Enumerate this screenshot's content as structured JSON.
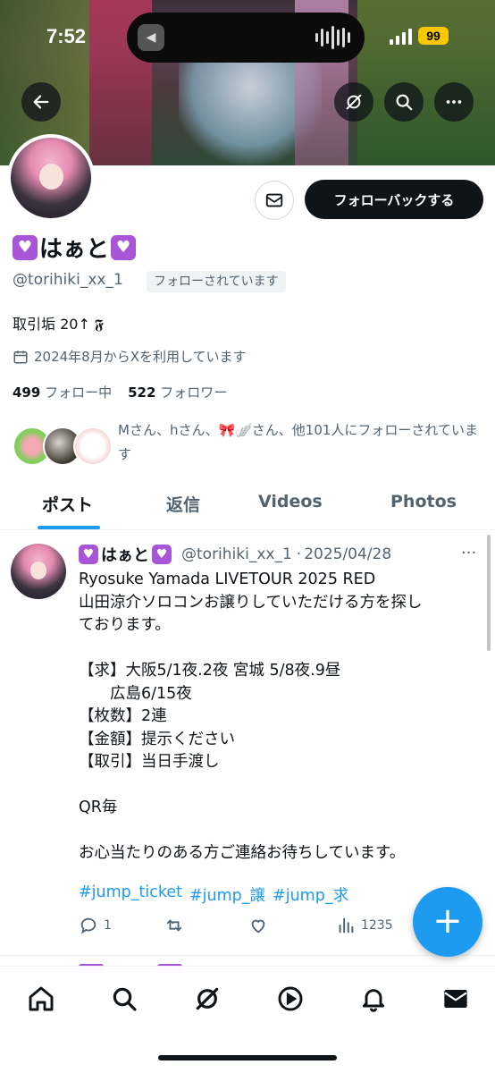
{
  "status_bar": {
    "time": "7:52",
    "battery": "99"
  },
  "profile": {
    "name": "はぁと",
    "handle": "@torihiki_xx_1",
    "follows_you": "フォローされています",
    "follow_back_label": "フォローバックする",
    "bio": "取引垢 20↑ 𝕱",
    "joined": "2024年8月からXを利用しています",
    "following_count": "499",
    "following_label": "フォロー中",
    "followers_count": "522",
    "followers_label": "フォロワー",
    "mutuals_text": "Mさん、hさん、🎀🪽さん、他101人にフォローされています"
  },
  "tabs": [
    "ポスト",
    "返信",
    "Videos",
    "Photos"
  ],
  "tweet": {
    "name": "はぁと",
    "handle": "@torihiki_xx_1",
    "date": "2025/04/28",
    "lines": [
      "Ryosuke Yamada LIVETOUR 2025 RED",
      "山田涼介ソロコンお譲りしていただける方を探し",
      "ております。",
      "",
      "【求】大阪5/1夜.2夜 宮城 5/8夜.9昼",
      "　　広島6/15夜",
      "【枚数】2連",
      "【金額】提示ください",
      "【取引】当日手渡し",
      "",
      "QR毎",
      "",
      "お心当たりのある方ご連絡お待ちしています。"
    ],
    "hashtags": [
      "#jump_ticket",
      "#jump_譲",
      "#jump_求"
    ],
    "replies": "1",
    "views": "1235"
  },
  "colors": {
    "accent": "#1d9bf0",
    "text": "#0f1419",
    "muted": "#536471"
  }
}
